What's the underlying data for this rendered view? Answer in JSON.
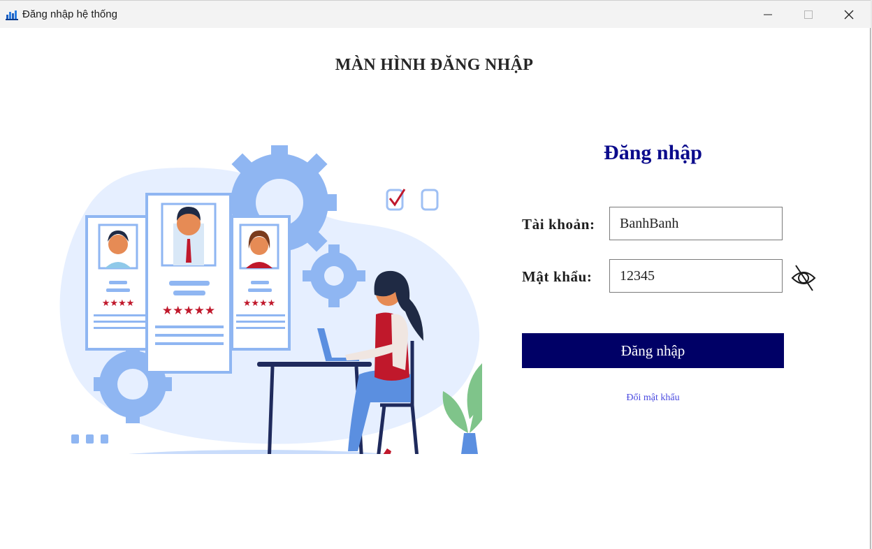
{
  "window": {
    "title": "Đăng nhập hệ thống",
    "controls": {
      "minimize": "minimize",
      "maximize": "maximize",
      "close": "close"
    }
  },
  "page": {
    "title": "MÀN HÌNH ĐĂNG NHẬP"
  },
  "login": {
    "heading": "Đăng nhập",
    "username_label": "Tài khoản:",
    "username_value": "BanhBanh",
    "password_label": "Mật khẩu:",
    "password_value": "12345",
    "password_toggle_icon": "eye-off-icon",
    "submit_label": "Đăng nhập",
    "change_password_link": "Đổi mật khẩu"
  },
  "colors": {
    "heading": "#0b0b8c",
    "button_bg": "#000066",
    "link": "#4a4ae0",
    "illustration_blue": "#8fb6f2"
  }
}
